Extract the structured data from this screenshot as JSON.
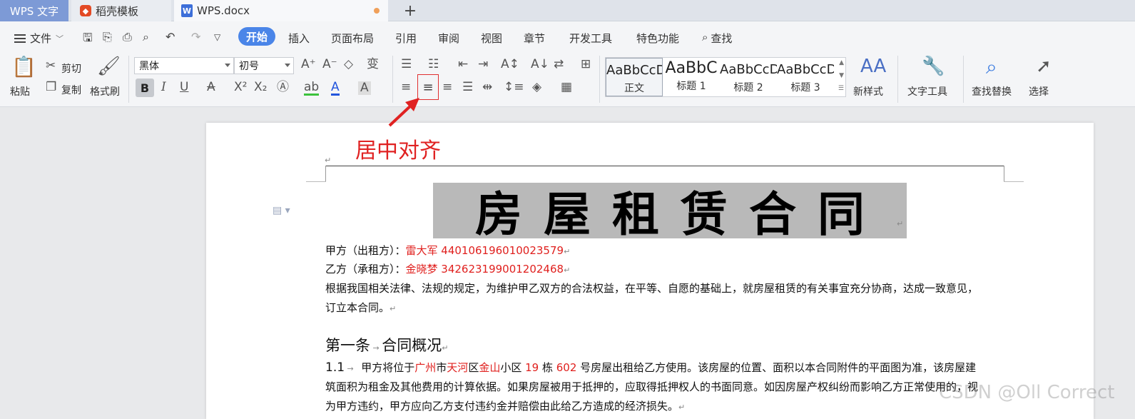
{
  "tabs": {
    "wps": "WPS 文字",
    "daoke": "稻壳模板",
    "doc": "WPS.docx",
    "add": "+"
  },
  "menu": {
    "file": "文件",
    "start": "开始",
    "items": [
      "插入",
      "页面布局",
      "引用",
      "审阅",
      "视图",
      "章节",
      "开发工具",
      "特色功能"
    ],
    "search": "查找"
  },
  "ribbon": {
    "paste": "粘贴",
    "cut": "剪切",
    "copy": "复制",
    "format_painter": "格式刷",
    "font_name": "黑体",
    "font_size": "初号",
    "styles": [
      {
        "preview": "AaBbCcD",
        "name": "正文"
      },
      {
        "preview": "AaBbC",
        "name": "标题 1"
      },
      {
        "preview": "AaBbCcD",
        "name": "标题 2"
      },
      {
        "preview": "AaBbCcD",
        "name": "标题 3"
      }
    ],
    "new_style": "新样式",
    "text_tools": "文字工具",
    "find_replace": "查找替换",
    "select": "选择"
  },
  "annotation": "居中对齐",
  "document": {
    "title": "房屋租赁合同",
    "party_a_label": "甲方（出租方）：",
    "party_a_value": "雷大军 440106196010023579",
    "party_b_label": "乙方（承租方）：",
    "party_b_value": "金晓梦 342623199001202468",
    "intro_1": "根据我国相关法律、法规的规定，为维护甲乙双方的合法权益，在平等、自愿的基础上，就房屋租赁的有关事宜充分协商，达成一致意见，",
    "intro_2": "订立本合同。",
    "section_1": "第一条",
    "section_1_title": "合同概况",
    "clause_num": "1.1",
    "clause_a": "甲方将位于",
    "city": "广州",
    "clause_b": "市",
    "district": "天河",
    "clause_c": "区",
    "community": "金山",
    "clause_d": "小区 ",
    "building": "19",
    "clause_e": " 栋 ",
    "room": "602",
    "clause_f": " 号房屋出租给乙方使用。该房屋的位置、面积以本合同附件的平面图为准，该房屋建",
    "clause_line2": "筑面积为租金及其他费用的计算依据。如果房屋被用于抵押的，应取得抵押权人的书面同意。如因房屋产权纠纷而影响乙方正常使用的，视",
    "clause_line3": "为甲方违约，甲方应向乙方支付违约金并赔偿由此给乙方造成的经济损失。"
  },
  "watermark": "CSDN @Oll Correct",
  "colors": {
    "accent": "#4a85e8",
    "annotation": "#e02222"
  }
}
